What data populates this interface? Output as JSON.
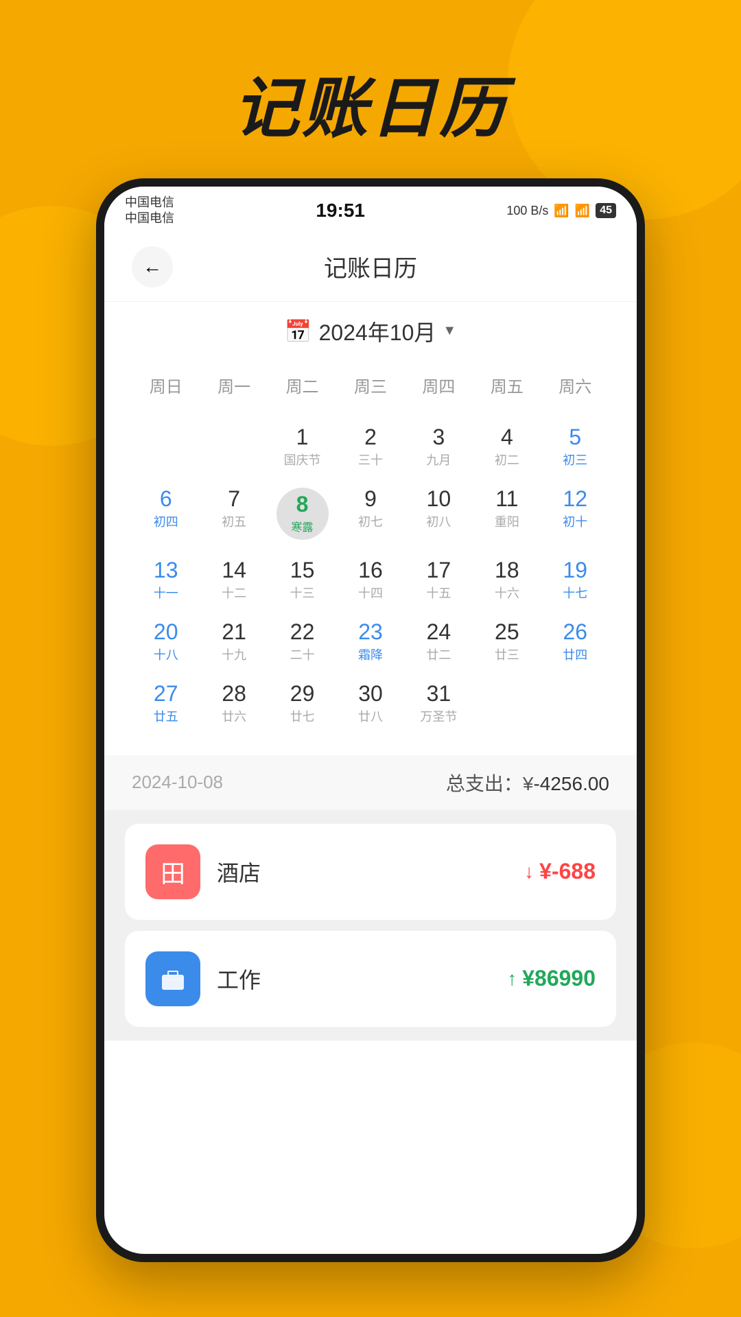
{
  "page": {
    "title": "记账日历",
    "background_color": "#F5A800"
  },
  "status_bar": {
    "carrier1": "中国电信",
    "carrier2": "中国电信",
    "time": "19:51",
    "icons": "🔔 ✱ 🎮",
    "network": "100 B/s",
    "battery": "45"
  },
  "header": {
    "back_label": "←",
    "title": "记账日历"
  },
  "calendar": {
    "month_icon": "📅",
    "month_label": "2024年10月",
    "weekdays": [
      "周日",
      "周一",
      "周二",
      "周三",
      "周四",
      "周五",
      "周六"
    ],
    "weeks": [
      [
        {
          "day": "",
          "sub": "",
          "type": "empty"
        },
        {
          "day": "",
          "sub": "",
          "type": "empty"
        },
        {
          "day": "1",
          "sub": "国庆节",
          "type": "normal"
        },
        {
          "day": "2",
          "sub": "三十",
          "type": "normal"
        },
        {
          "day": "3",
          "sub": "九月",
          "type": "normal"
        },
        {
          "day": "4",
          "sub": "初二",
          "type": "normal"
        },
        {
          "day": "5",
          "sub": "初三",
          "type": "blue"
        }
      ],
      [
        {
          "day": "6",
          "sub": "初四",
          "type": "blue"
        },
        {
          "day": "7",
          "sub": "初五",
          "type": "normal"
        },
        {
          "day": "8",
          "sub": "寒露",
          "type": "selected"
        },
        {
          "day": "9",
          "sub": "初七",
          "type": "normal"
        },
        {
          "day": "10",
          "sub": "初八",
          "type": "normal"
        },
        {
          "day": "11",
          "sub": "重阳",
          "type": "normal"
        },
        {
          "day": "12",
          "sub": "初十",
          "type": "blue"
        }
      ],
      [
        {
          "day": "13",
          "sub": "十一",
          "type": "blue"
        },
        {
          "day": "14",
          "sub": "十二",
          "type": "normal"
        },
        {
          "day": "15",
          "sub": "十三",
          "type": "normal"
        },
        {
          "day": "16",
          "sub": "十四",
          "type": "normal"
        },
        {
          "day": "17",
          "sub": "十五",
          "type": "normal"
        },
        {
          "day": "18",
          "sub": "十六",
          "type": "normal"
        },
        {
          "day": "19",
          "sub": "十七",
          "type": "blue"
        }
      ],
      [
        {
          "day": "20",
          "sub": "十八",
          "type": "blue"
        },
        {
          "day": "21",
          "sub": "十九",
          "type": "normal"
        },
        {
          "day": "22",
          "sub": "二十",
          "type": "normal"
        },
        {
          "day": "23",
          "sub": "霜降",
          "type": "highlight"
        },
        {
          "day": "24",
          "sub": "廿二",
          "type": "normal"
        },
        {
          "day": "25",
          "sub": "廿三",
          "type": "normal"
        },
        {
          "day": "26",
          "sub": "廿四",
          "type": "blue"
        }
      ],
      [
        {
          "day": "27",
          "sub": "廿五",
          "type": "blue"
        },
        {
          "day": "28",
          "sub": "廿六",
          "type": "normal"
        },
        {
          "day": "29",
          "sub": "廿七",
          "type": "normal"
        },
        {
          "day": "30",
          "sub": "廿八",
          "type": "normal"
        },
        {
          "day": "31",
          "sub": "万圣节",
          "type": "normal"
        },
        {
          "day": "",
          "sub": "",
          "type": "empty"
        },
        {
          "day": "",
          "sub": "",
          "type": "empty"
        }
      ]
    ]
  },
  "summary": {
    "date": "2024-10-08",
    "total_label": "总支出：¥",
    "total_amount": "-4256.00"
  },
  "transactions": [
    {
      "id": 1,
      "icon": "田",
      "icon_color": "red",
      "name": "酒店",
      "arrow": "down",
      "amount": "¥-688",
      "amount_type": "expense"
    },
    {
      "id": 2,
      "icon": "💼",
      "icon_color": "blue",
      "name": "工作",
      "arrow": "up",
      "amount": "¥86990",
      "amount_type": "income"
    }
  ]
}
